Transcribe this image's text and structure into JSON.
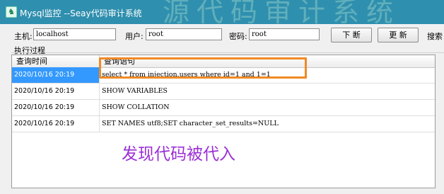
{
  "window": {
    "title": "Mysql监控 --Seay代码审计系统",
    "icon": "seay-app-icon",
    "title_watermark": "源代码审计系统"
  },
  "form": {
    "host_label": "主机:",
    "host_value": "localhost",
    "user_label": "用户:",
    "user_value": "root",
    "password_label": "密码:",
    "password_value": "root",
    "disconnect_button": "下 断",
    "refresh_button": "更 新",
    "search_label": "搜索"
  },
  "group": {
    "label": "执行过程"
  },
  "table": {
    "columns": [
      "查询时间",
      "查询语句"
    ],
    "rows": [
      {
        "time": "2020/10/16 20:19",
        "query": "select * from injection.users where id=1 and 1=1",
        "selected": true
      },
      {
        "time": "2020/10/16 20:19",
        "query": "SHOW VARIABLES",
        "selected": false
      },
      {
        "time": "2020/10/16 20:19",
        "query": "SHOW COLLATION",
        "selected": false
      },
      {
        "time": "2020/10/16 20:19",
        "query": "SET NAMES utf8;SET character_set_results=NULL",
        "selected": false
      }
    ]
  },
  "annotation": {
    "text": "发现代码被代入",
    "color": "#9b2fd6",
    "box_color": "#f08a24"
  },
  "colors": {
    "titlebar": "#2f8fae",
    "selection": "#3399ff"
  }
}
